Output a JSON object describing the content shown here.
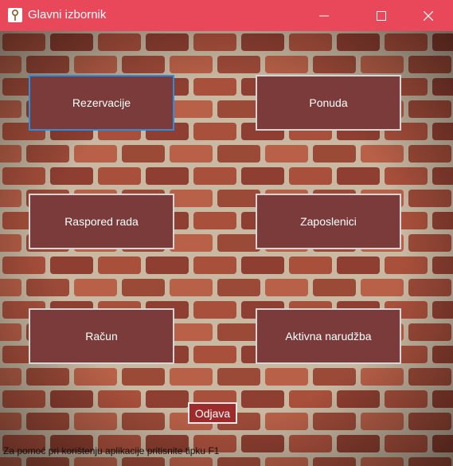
{
  "window": {
    "title": "Glavni izbornik",
    "accent": "#e8485a"
  },
  "menu": {
    "rezervacije": "Rezervacije",
    "ponuda": "Ponuda",
    "raspored": "Raspored rada",
    "zaposlenici": "Zaposlenici",
    "racun": "Račun",
    "narudzba": "Aktivna narudžba"
  },
  "logout_label": "Odjava",
  "help_text": "Za pomoć pri korištenju aplikacije pritisnite tipku F1",
  "colors": {
    "button_bg": "#7b3b3a",
    "logout_bg": "#9e2b2b",
    "focus_border": "#2a8de0"
  }
}
